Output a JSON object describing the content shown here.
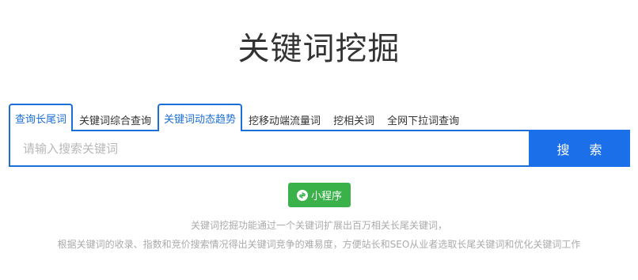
{
  "page": {
    "title": "关键词挖掘"
  },
  "tabs": [
    {
      "label": "查询长尾词",
      "active": true
    },
    {
      "label": "关键词综合查询",
      "active": false
    },
    {
      "label": "关键词动态趋势",
      "active": true
    },
    {
      "label": "挖移动端流量词",
      "active": false
    },
    {
      "label": "挖相关词",
      "active": false
    },
    {
      "label": "全网下拉词查询",
      "active": false
    }
  ],
  "search": {
    "placeholder": "请输入搜索关键词",
    "value": "",
    "button_label": "搜 索"
  },
  "mini_program": {
    "label": "小程序",
    "icon": "mini-program-icon"
  },
  "description": {
    "line1": "关键词挖掘功能通过一个关键词扩展出百万相关长尾关键词，",
    "line2": "根据关键词的收录、指数和竞价搜索情况得出关键词竞争的难易度，方便站长和SEO从业者选取长尾关键词和优化关键词工作"
  },
  "colors": {
    "accent": "#1b6fd8",
    "button": "#1b6fe8",
    "mini_program": "#3bb14a",
    "muted_text": "#aaaaaa"
  }
}
